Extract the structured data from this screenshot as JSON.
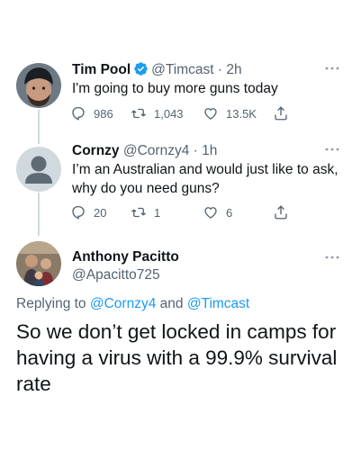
{
  "tweets": [
    {
      "name": "Tim Pool",
      "handle": "@Timcast",
      "time": "· 2h",
      "verified": true,
      "text": "I'm going to buy more guns today",
      "replies": "986",
      "retweets": "1,043",
      "likes": "13.5K",
      "avatar": "bearded-man-beanie-avatar"
    },
    {
      "name": "Cornzy",
      "handle": "@Cornzy4",
      "time": "· 1h",
      "verified": false,
      "text": "I’m an Australian and would just like to ask, why do you need guns?",
      "replies": "20",
      "retweets": "1",
      "likes": "6",
      "avatar": "default-profile-avatar"
    }
  ],
  "main_tweet": {
    "name": "Anthony Pacitto",
    "handle": "@Apacitto725",
    "replying_prefix": "Replying to",
    "reply_to_1": "@Cornzy4",
    "reply_and": "and",
    "reply_to_2": "@Timcast",
    "text": "So we don’t get locked in camps for having a virus with a 99.9% survival rate",
    "avatar": "family-photo-avatar"
  },
  "colors": {
    "text": "#0f1419",
    "secondary": "#536471",
    "link": "#1d9bf0",
    "thread_line": "#cfd9de",
    "verified": "#1d9bf0"
  },
  "icons": [
    "reply-icon",
    "retweet-icon",
    "like-icon",
    "share-icon",
    "more-icon",
    "verified-badge-icon"
  ]
}
